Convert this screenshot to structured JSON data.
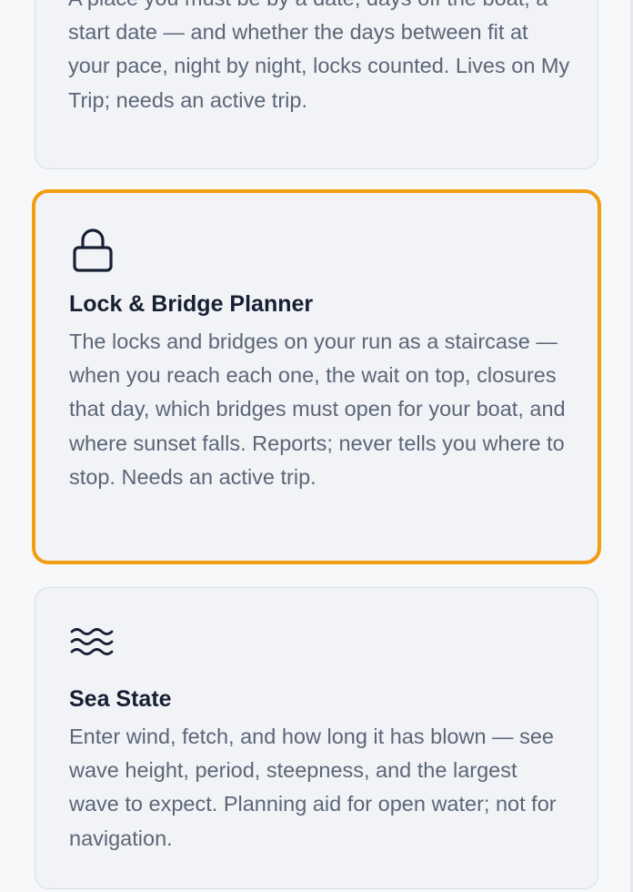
{
  "cards": [
    {
      "id": "trip-fit",
      "title": "",
      "description": "A place you must be by a date, days off the boat, a start date — and whether the days between fit at your pace, night by night, locks counted. Lives on My Trip; needs an active trip."
    },
    {
      "id": "lock-bridge-planner",
      "icon": "lock-icon",
      "title": "Lock & Bridge Planner",
      "description": "The locks and bridges on your run as a staircase — when you reach each one, the wait on top, closures that day, which bridges must open for your boat, and where sunset falls. Reports; never tells you where to stop. Needs an active trip.",
      "selected": true
    },
    {
      "id": "sea-state",
      "icon": "waves-icon",
      "title": "Sea State",
      "description": "Enter wind, fetch, and how long it has blown — see wave height, period, steepness, and the largest wave to expect. Planning aid for open water; not for navigation."
    }
  ],
  "colors": {
    "selected_border": "#f29d12",
    "card_background": "#f1f3f6",
    "card_border": "#d8dce3",
    "title_text": "#172033",
    "body_text": "#5c6678"
  }
}
